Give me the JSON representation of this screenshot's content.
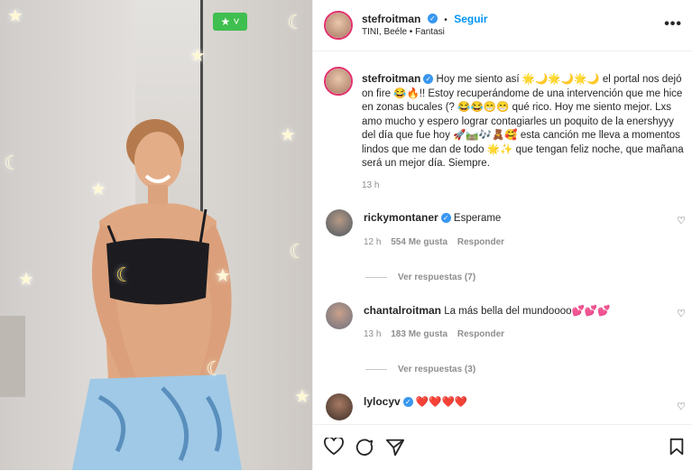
{
  "photo": {
    "tag_icon": "star-icon"
  },
  "post": {
    "author": "stefroitman",
    "follow_label": "Seguir",
    "separator": "•",
    "subtitle": "TINI, Beéle • Fantasi",
    "more_icon": "ellipsis-icon",
    "more_label": "•••"
  },
  "caption": {
    "username": "stefroitman",
    "text": "Hoy me siento así 🌟🌙🌟🌙🌟🌙 el portal nos dejó on fire 😂🔥!! Estoy recuperándome de una intervención que me hice en zonas bucales (? 😂😂😁😁 qué rico. Hoy me siento mejor. Lxs amo mucho y espero lograr contagiarles un poquito de la enershyyy del día que fue hoy 🚀🛤️🎶🧸🥰 esta canción me lleva a momentos lindos que me dan de todo 🌟✨ que tengan feliz noche, que mañana será un mejor día. Siempre.",
    "time": "13 h"
  },
  "comments": [
    {
      "username": "rickymontaner",
      "verified": true,
      "text": "Esperame",
      "time": "12 h",
      "likes": "554 Me gusta",
      "reply": "Responder",
      "view_replies": "Ver respuestas (7)"
    },
    {
      "username": "chantalroitman",
      "verified": false,
      "text": "La más bella del mundoooo💕💕💕",
      "time": "13 h",
      "likes": "183 Me gusta",
      "reply": "Responder",
      "view_replies": "Ver respuestas (3)"
    },
    {
      "username": "lylocyv",
      "verified": true,
      "text": "❤️❤️❤️❤️"
    }
  ],
  "colors": {
    "accent": "#0095f6",
    "verified": "#3897f0",
    "tag": "#3fbf4f"
  }
}
